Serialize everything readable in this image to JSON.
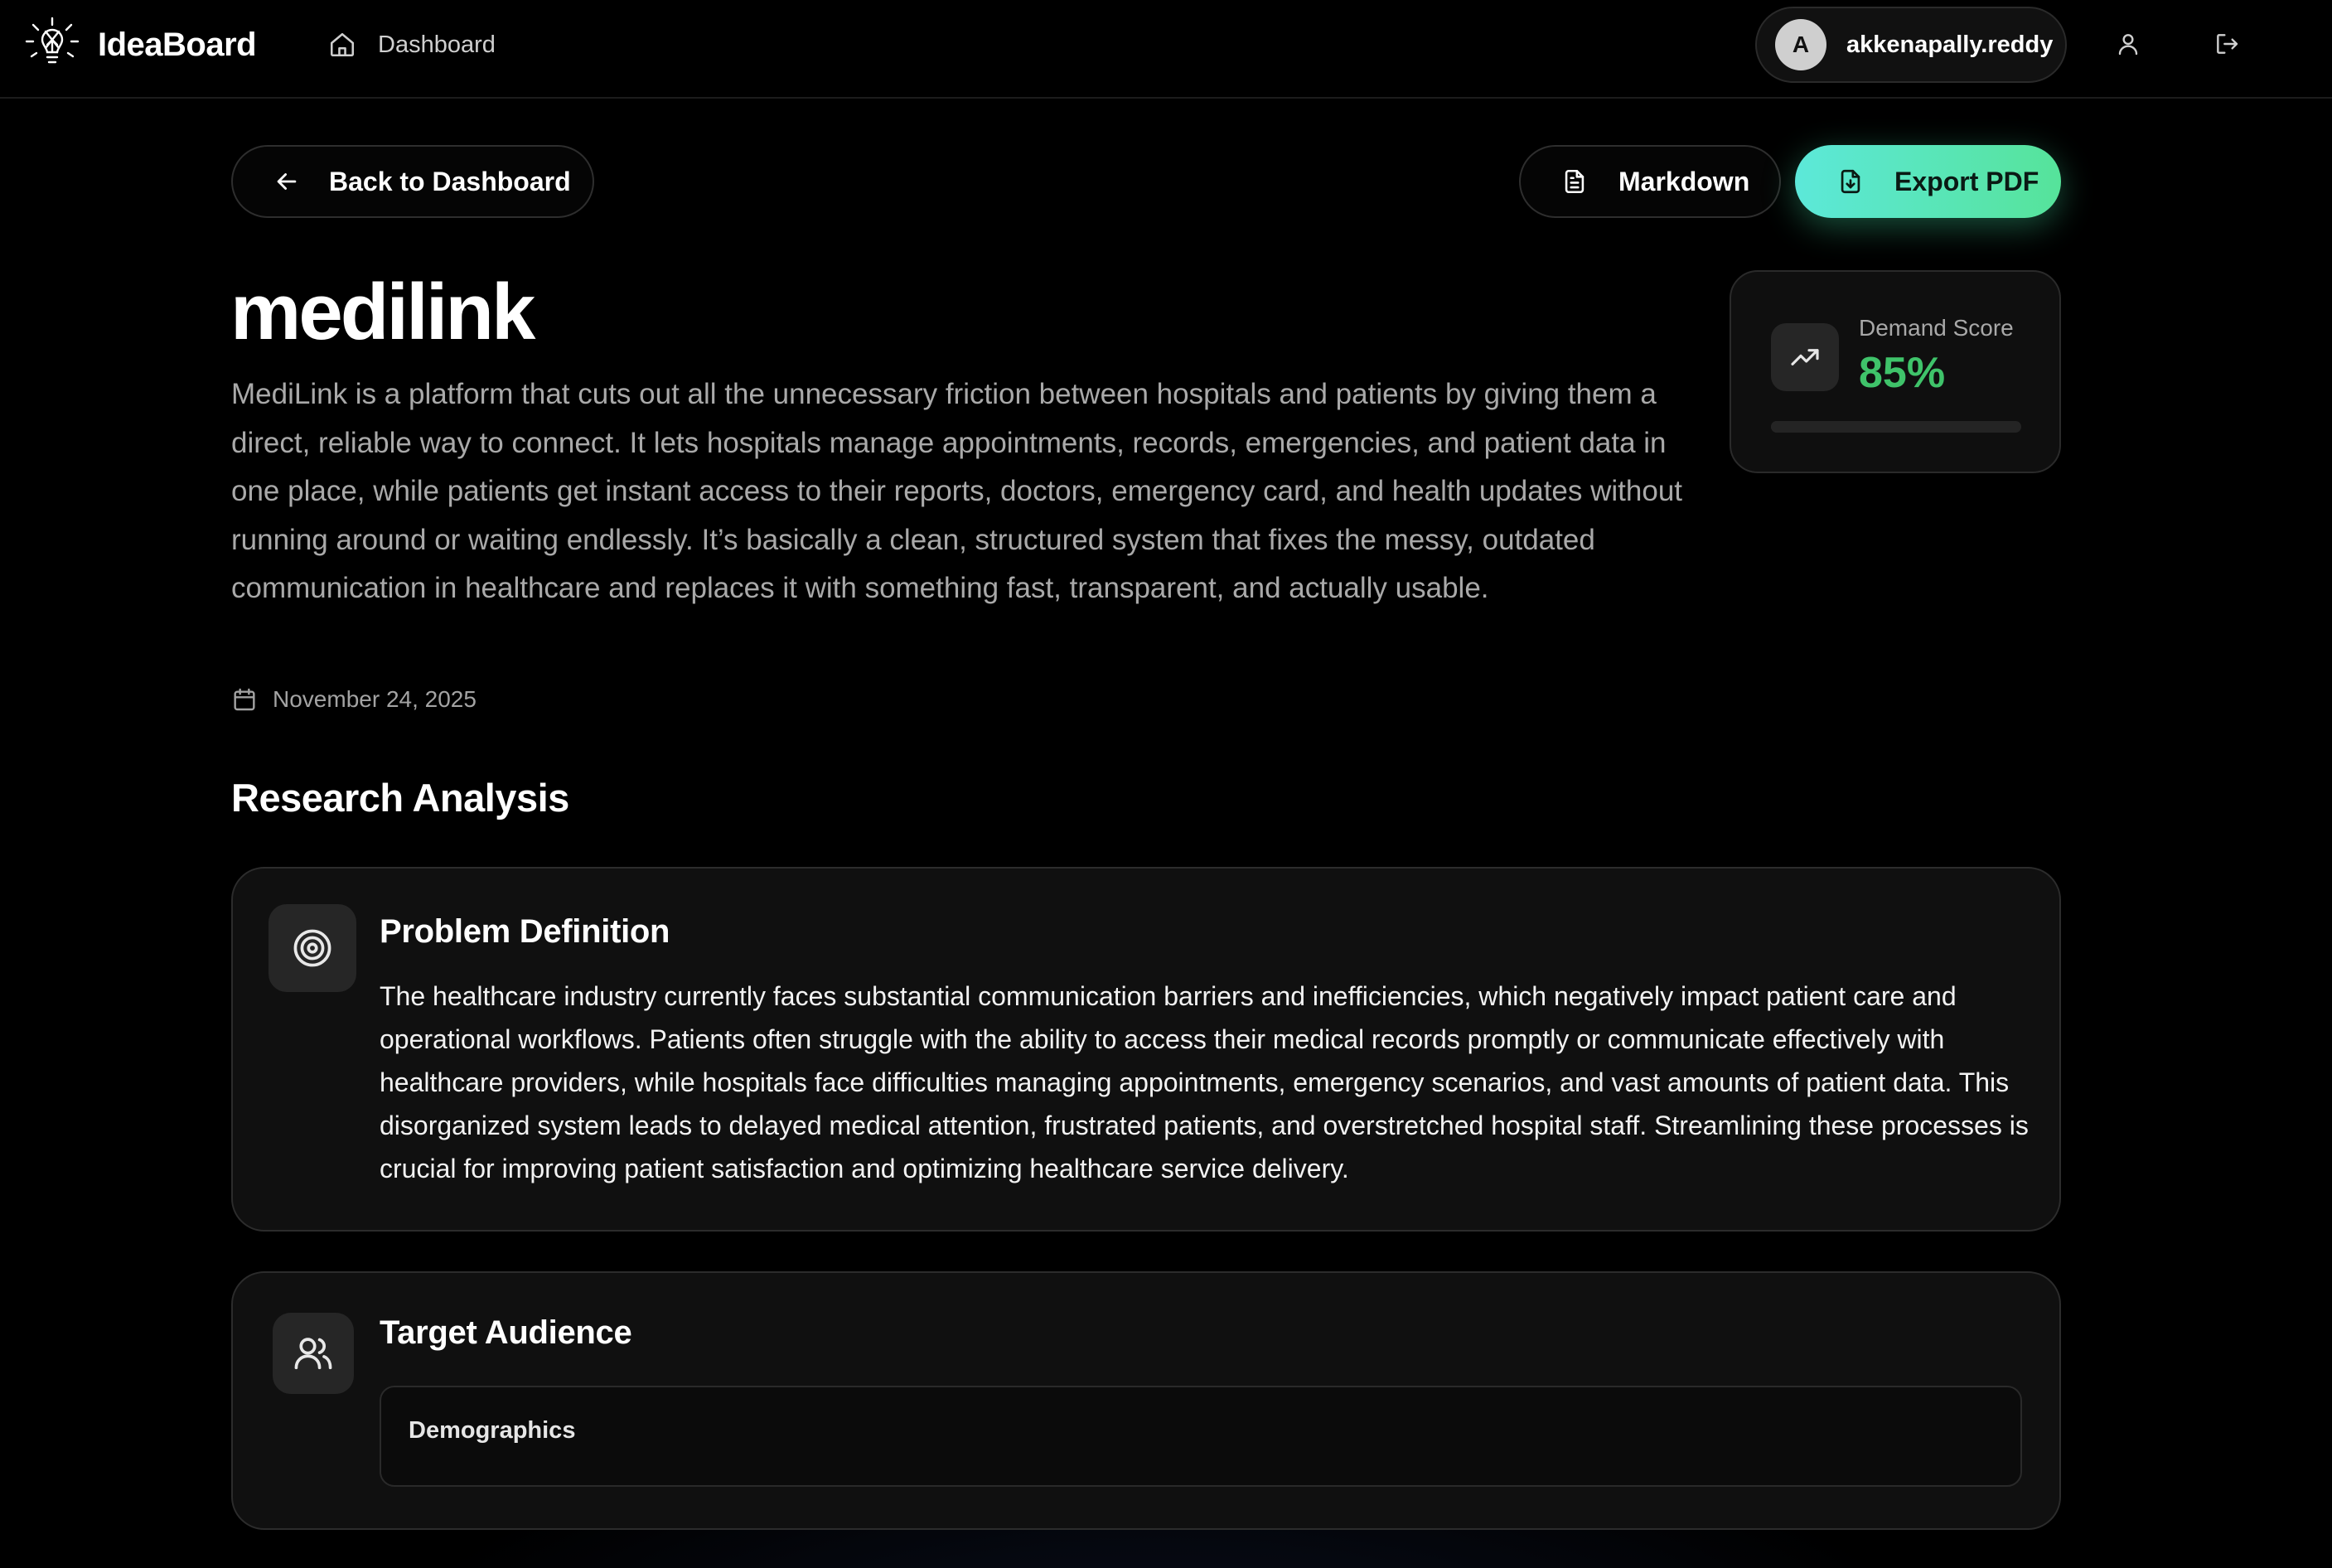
{
  "brand": {
    "name": "IdeaBoard",
    "logo_icon": "lightbulb-logo-icon"
  },
  "nav": {
    "dashboard_label": "Dashboard",
    "dashboard_icon": "home-icon"
  },
  "user": {
    "avatar_initial": "A",
    "username": "akkenapally.reddy",
    "profile_icon": "user-icon",
    "logout_icon": "logout-icon"
  },
  "actions": {
    "back_label": "Back to Dashboard",
    "markdown_label": "Markdown",
    "export_pdf_label": "Export PDF"
  },
  "idea": {
    "title": "medilink",
    "description": "MediLink is a platform that cuts out all the unnecessary friction between hospitals and patients by giving them a direct, reliable way to connect. It lets hospitals manage appointments, records, emergencies, and patient data in one place, while patients get instant access to their reports, doctors, emergency card, and health updates without running around or waiting endlessly. It’s basically a clean, structured system that fixes the messy, outdated communication in healthcare and replaces it with something fast, transparent, and actually usable.",
    "date": "November 24, 2025"
  },
  "demand": {
    "label": "Demand Score",
    "value": "85%",
    "fraction": 0.85,
    "color": "#3fc36a"
  },
  "research": {
    "section_title": "Research Analysis",
    "problem": {
      "title": "Problem Definition",
      "icon": "target-icon",
      "text": "The healthcare industry currently faces substantial communication barriers and inefficiencies, which negatively impact patient care and operational workflows. Patients often struggle with the ability to access their medical records promptly or communicate effectively with healthcare providers, while hospitals face difficulties managing appointments, emergency scenarios, and vast amounts of patient data. This disorganized system leads to delayed medical attention, frustrated patients, and overstretched hospital staff. Streamlining these processes is crucial for improving patient satisfaction and optimizing healthcare service delivery."
    },
    "audience": {
      "title": "Target Audience",
      "icon": "users-icon",
      "demographics_label": "Demographics"
    }
  },
  "colors": {
    "accent_gradient_start": "#5ce8d9",
    "accent_gradient_end": "#56e39a",
    "background": "#000000",
    "card_background": "#101010"
  }
}
